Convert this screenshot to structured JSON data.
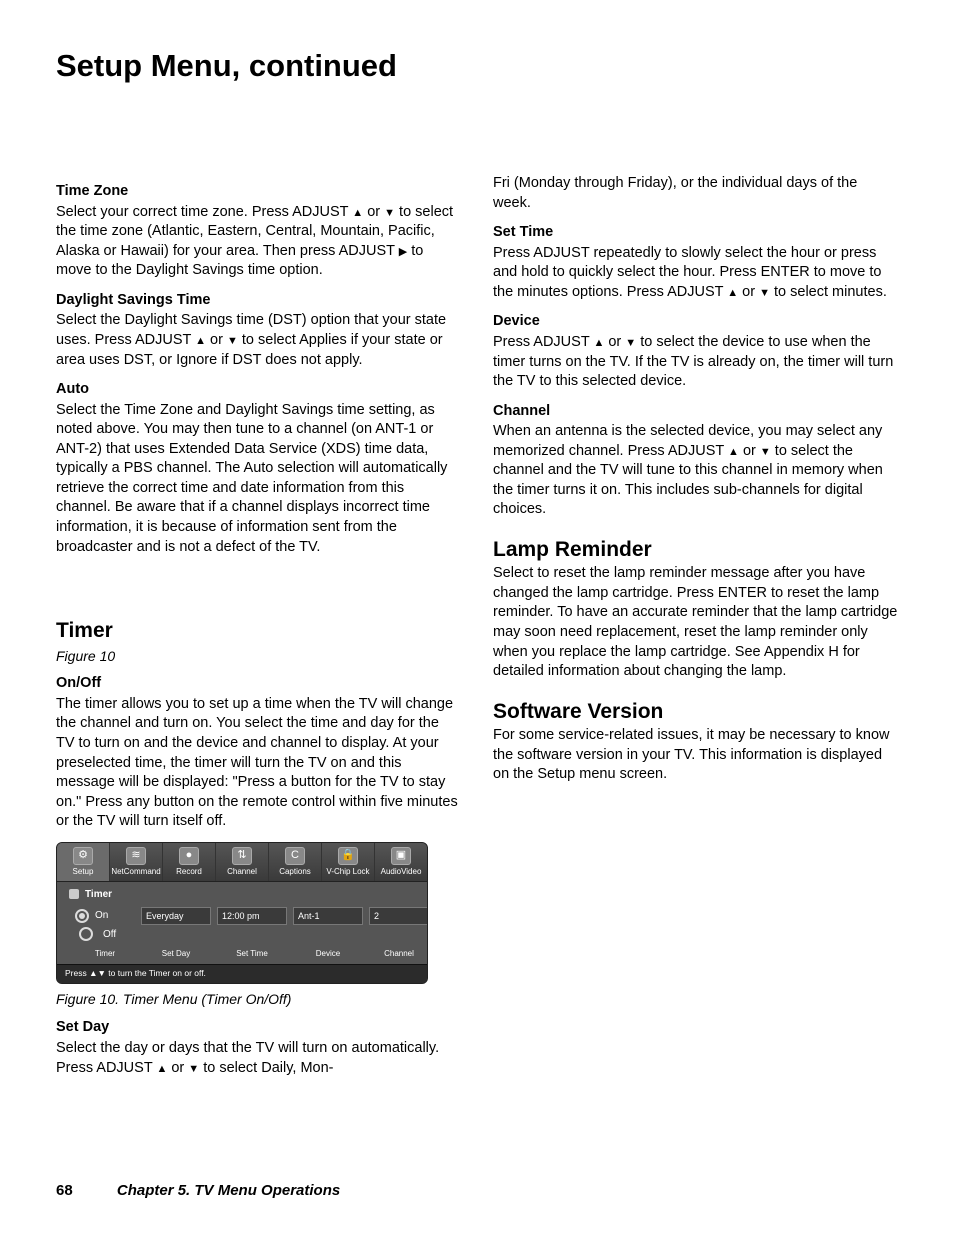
{
  "page_title": "Setup Menu, continued",
  "left": {
    "tz_head": "Time Zone",
    "tz_body_a": "Select your correct time zone.  Press ADJUST ",
    "tz_body_b": " or ",
    "tz_body_c": " to select the time zone (Atlantic, Eastern, Central, Mountain, Pacific, Alaska or Hawaii) for your area.  Then press ADJUST ",
    "tz_body_d": "  to move to the Daylight Savings time option.",
    "dst_head": "Daylight Savings Time",
    "dst_body_a": "Select the Daylight Savings time (DST) option that your state uses.  Press ADJUST ",
    "dst_body_b": " or ",
    "dst_body_c": " to select Applies if your state or area uses DST, or Ignore if DST does not apply.",
    "auto_head": "Auto",
    "auto_body": "Select the Time Zone and Daylight Savings time setting, as noted above.  You may then tune to a channel (on ANT-1 or ANT-2) that uses Extended Data Service (XDS) time data, typically a PBS channel.  The Auto selection will automatically retrieve the correct time and date information from this channel. Be aware that if a channel displays incorrect time information, it is because of information sent from the broadcaster and is not a defect of the TV.",
    "timer_h2": "Timer",
    "timer_fig": "Figure 10",
    "onoff_head": "On/Off",
    "onoff_body": "The timer allows you to set up a time when the TV will change the channel and turn on.  You select the time and day for the TV to turn on and the device and channel to display.  At your preselected time, the timer will turn the TV on and this message will be displayed: \"Press a button for the TV to stay on.\"  Press any button on the remote control within five minutes or the TV will turn itself off.",
    "setday_head": "Set Day",
    "setday_body_a": "Select the day or days that the TV will turn on automatically.  Press ADJUST ",
    "setday_body_b": " or ",
    "setday_body_c": " to select Daily, Mon-",
    "caption": "Figure 10. Timer Menu (Timer On/Off)"
  },
  "right": {
    "cont": "Fri (Monday through Friday), or the individual days of the week.",
    "settime_head": "Set Time",
    "settime_body_a": "Press ADJUST  repeatedly to slowly select the hour or press and hold to quickly select the hour.  Press ENTER to move to the minutes options.  Press ADJUST ",
    "settime_body_b": " or ",
    "settime_body_c": " to select minutes.",
    "device_head": "Device",
    "device_body_a": "Press ADJUST ",
    "device_body_b": " or ",
    "device_body_c": " to select the device to use when the timer turns on the TV.  If the TV is already on, the timer will turn the TV to this selected device.",
    "channel_head": "Channel",
    "channel_body_a": "When an antenna is the selected device, you may select any memorized channel.  Press ADJUST ",
    "channel_body_b": " or ",
    "channel_body_c": " to select the channel and the TV will tune to this channel in memory when the timer turns it on.  This includes sub-channels for digital choices.",
    "lamp_h2": "Lamp Reminder",
    "lamp_body": "Select to reset the lamp reminder message after you have changed the lamp cartridge.  Press ENTER to reset the lamp reminder.  To have an accurate reminder that the lamp cartridge may soon need replacement, reset the lamp reminder only when you replace the lamp cartridge.  See Appendix H for detailed information about changing the lamp.",
    "sw_h2": "Software Version",
    "sw_body": "For some service-related issues, it may be necessary to know the software version in your TV.  This information is displayed on the Setup menu screen."
  },
  "menu": {
    "tabs": [
      "Setup",
      "NetCommand",
      "Record",
      "Channel",
      "Captions",
      "V-Chip Lock",
      "AudioVideo"
    ],
    "title": "Timer",
    "on": "On",
    "off": "Off",
    "day": "Everyday",
    "time": "12:00 pm",
    "device": "Ant-1",
    "channel": "2",
    "labels": [
      "Timer",
      "Set Day",
      "Set Time",
      "Device",
      "Channel"
    ],
    "help": "Press ▲▼ to turn the Timer on or off."
  },
  "footer": {
    "page": "68",
    "chapter": "Chapter 5. TV Menu Operations"
  }
}
